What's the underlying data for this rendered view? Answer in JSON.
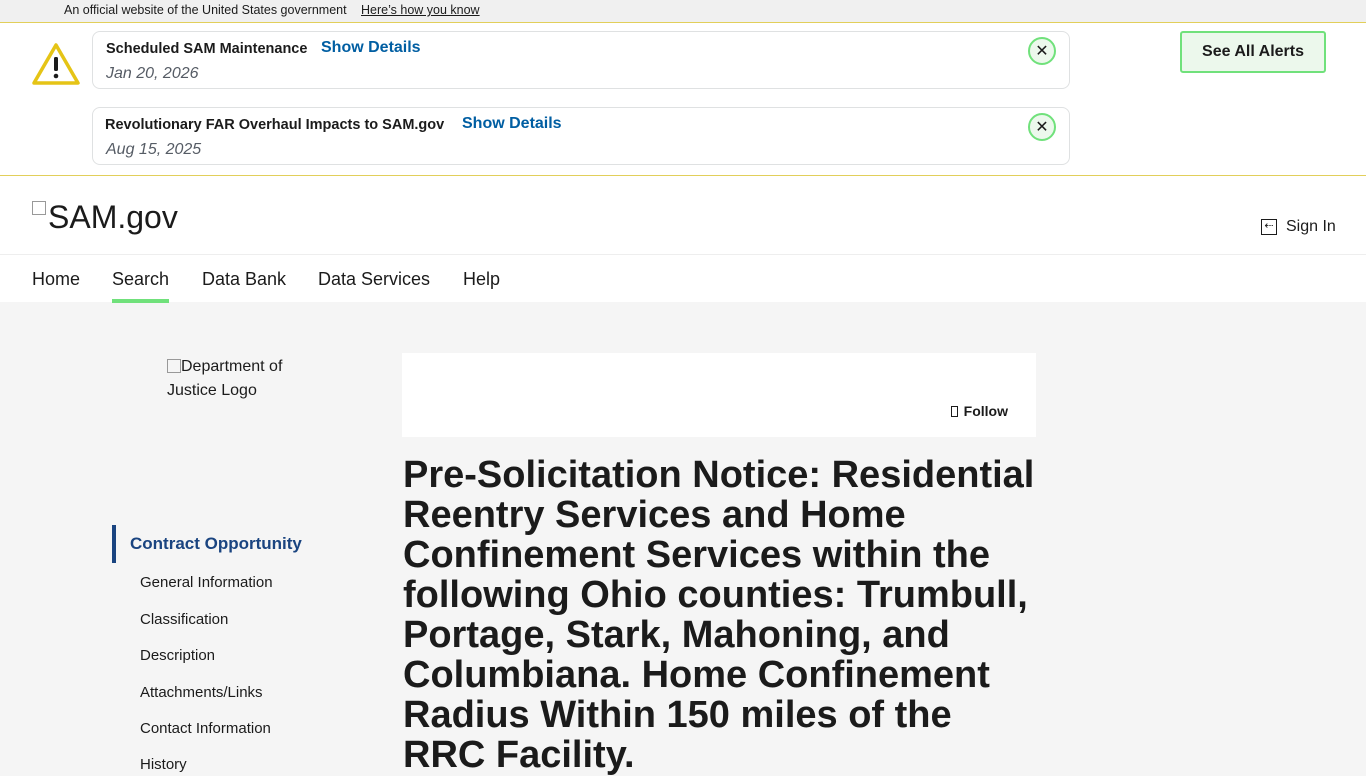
{
  "gov_banner": {
    "text": "An official website of the United States government",
    "link": "Here’s how you know"
  },
  "alerts": {
    "items": [
      {
        "title": "Scheduled SAM Maintenance",
        "action": "Show Details",
        "date": "Jan 20, 2026",
        "close": "✕"
      },
      {
        "title": "Revolutionary FAR Overhaul Impacts to SAM.gov",
        "action": "Show Details",
        "date": "Aug 15, 2025",
        "close": "✕"
      }
    ],
    "see_all": "See All Alerts",
    "icon": "warning-triangle-icon",
    "accent": "#e5c416"
  },
  "header": {
    "logo_alt": "SAM.gov",
    "sign_in": "Sign In",
    "sign_in_icon": "sign-in-icon"
  },
  "nav": {
    "items": [
      "Home",
      "Search",
      "Data Bank",
      "Data Services",
      "Help"
    ],
    "active": "Search",
    "active_color": "#70e17b"
  },
  "sidebar": {
    "agency_logo_alt": "Department of Justice Logo",
    "section": "Contract Opportunity",
    "items": [
      "General Information",
      "Classification",
      "Description",
      "Attachments/Links",
      "Contact Information",
      "History"
    ]
  },
  "main": {
    "follow_label": "Follow",
    "follow_icon": "bookmark-icon",
    "title": "Pre-Solicitation Notice: Residential Reentry Services and Home Confinement Services within the following Ohio counties: Trumbull, Portage, Stark, Mahoning, and Columbiana. Home Confinement Radius Within 150 miles of the RRC Facility."
  }
}
